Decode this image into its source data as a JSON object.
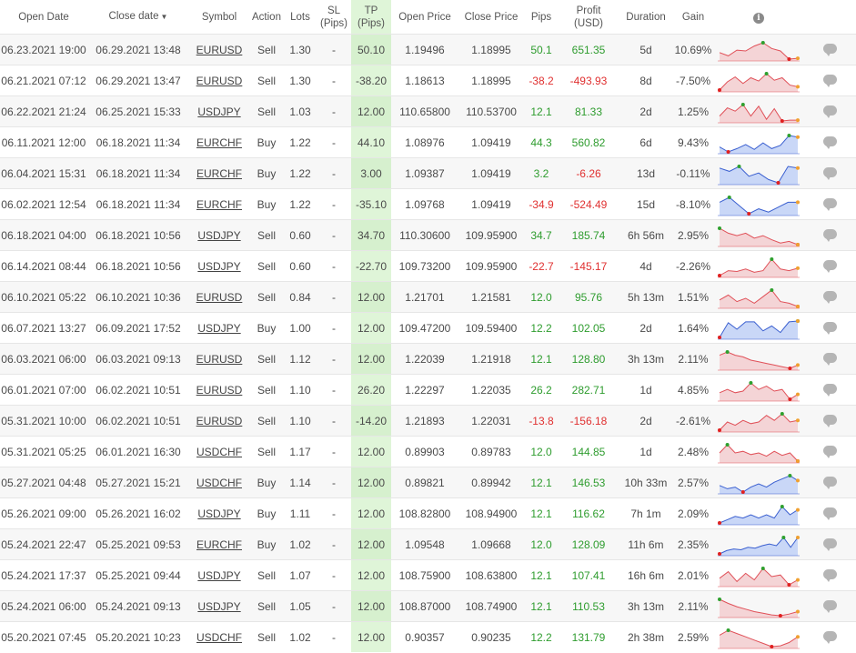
{
  "headers": {
    "open_date": "Open Date",
    "close_date": "Close date",
    "symbol": "Symbol",
    "action": "Action",
    "lots": "Lots",
    "sl": "SL",
    "sl_unit": "(Pips)",
    "tp": "TP",
    "tp_unit": "(Pips)",
    "open_price": "Open Price",
    "close_price": "Close Price",
    "pips": "Pips",
    "profit": "Profit",
    "profit_unit": "(USD)",
    "duration": "Duration",
    "gain": "Gain",
    "info_icon": "i"
  },
  "colors": {
    "positive": "#2e9c2e",
    "negative": "#e03030",
    "tp_bg": "#dff5d8",
    "sell_fill": "#f4d4d6",
    "sell_line": "#e05058",
    "buy_fill": "#c9d7f7",
    "buy_line": "#3a5fd0"
  },
  "trades": [
    {
      "open": "06.23.2021 19:00",
      "close": "06.29.2021 13:48",
      "symbol": "EURUSD",
      "action": "Sell",
      "lots": "1.30",
      "sl": "-",
      "tp": "50.10",
      "open_price": "1.19496",
      "close_price": "1.18995",
      "pips": "50.1",
      "profit": "651.35",
      "duration": "5d",
      "gain": "10.69%",
      "spark": [
        0.4,
        0.2,
        0.55,
        0.5,
        0.8,
        1.0,
        0.65,
        0.5,
        0.0,
        0.05
      ]
    },
    {
      "open": "06.21.2021 07:12",
      "close": "06.29.2021 13:47",
      "symbol": "EURUSD",
      "action": "Sell",
      "lots": "1.30",
      "sl": "-",
      "tp": "-38.20",
      "open_price": "1.18613",
      "close_price": "1.18995",
      "pips": "-38.2",
      "profit": "-493.93",
      "duration": "8d",
      "gain": "-7.50%",
      "spark": [
        0.0,
        0.5,
        0.8,
        0.4,
        0.75,
        0.55,
        1.0,
        0.6,
        0.75,
        0.3,
        0.2
      ]
    },
    {
      "open": "06.22.2021 21:24",
      "close": "06.25.2021 15:33",
      "symbol": "USDJPY",
      "action": "Sell",
      "lots": "1.03",
      "sl": "-",
      "tp": "12.00",
      "open_price": "110.65800",
      "close_price": "110.53700",
      "pips": "12.1",
      "profit": "81.33",
      "duration": "2d",
      "gain": "1.25%",
      "spark": [
        0.3,
        0.8,
        0.6,
        1.0,
        0.3,
        0.9,
        0.1,
        0.75,
        0.0,
        0.05,
        0.05
      ]
    },
    {
      "open": "06.11.2021 12:00",
      "close": "06.18.2021 11:34",
      "symbol": "EURCHF",
      "action": "Buy",
      "lots": "1.22",
      "sl": "-",
      "tp": "44.10",
      "open_price": "1.08976",
      "close_price": "1.09419",
      "pips": "44.3",
      "profit": "560.82",
      "duration": "6d",
      "gain": "9.43%",
      "spark": [
        0.3,
        0.0,
        0.2,
        0.45,
        0.15,
        0.55,
        0.2,
        0.4,
        1.0,
        0.9
      ]
    },
    {
      "open": "06.04.2021 15:31",
      "close": "06.18.2021 11:34",
      "symbol": "EURCHF",
      "action": "Buy",
      "lots": "1.22",
      "sl": "-",
      "tp": "3.00",
      "open_price": "1.09387",
      "close_price": "1.09419",
      "pips": "3.2",
      "profit": "-6.26",
      "duration": "13d",
      "gain": "-0.11%",
      "spark": [
        0.9,
        0.7,
        1.0,
        0.4,
        0.6,
        0.2,
        0.0,
        1.0,
        0.9
      ]
    },
    {
      "open": "06.02.2021 12:54",
      "close": "06.18.2021 11:34",
      "symbol": "EURCHF",
      "action": "Buy",
      "lots": "1.22",
      "sl": "-",
      "tp": "-35.10",
      "open_price": "1.09768",
      "close_price": "1.09419",
      "pips": "-34.9",
      "profit": "-524.49",
      "duration": "15d",
      "gain": "-8.10%",
      "spark": [
        0.7,
        1.0,
        0.5,
        0.0,
        0.3,
        0.1,
        0.4,
        0.7,
        0.7
      ]
    },
    {
      "open": "06.18.2021 04:00",
      "close": "06.18.2021 10:56",
      "symbol": "USDJPY",
      "action": "Sell",
      "lots": "0.60",
      "sl": "-",
      "tp": "34.70",
      "open_price": "110.30600",
      "close_price": "109.95900",
      "pips": "34.7",
      "profit": "185.74",
      "duration": "6h 56m",
      "gain": "2.95%",
      "spark": [
        1.0,
        0.7,
        0.55,
        0.7,
        0.4,
        0.55,
        0.3,
        0.1,
        0.2,
        0.0
      ]
    },
    {
      "open": "06.14.2021 08:44",
      "close": "06.18.2021 10:56",
      "symbol": "USDJPY",
      "action": "Sell",
      "lots": "0.60",
      "sl": "-",
      "tp": "-22.70",
      "open_price": "109.73200",
      "close_price": "109.95900",
      "pips": "-22.7",
      "profit": "-145.17",
      "duration": "4d",
      "gain": "-2.26%",
      "spark": [
        0.0,
        0.3,
        0.25,
        0.4,
        0.2,
        0.3,
        1.0,
        0.4,
        0.3,
        0.45
      ]
    },
    {
      "open": "06.10.2021 05:22",
      "close": "06.10.2021 10:36",
      "symbol": "EURUSD",
      "action": "Sell",
      "lots": "0.84",
      "sl": "-",
      "tp": "12.00",
      "open_price": "1.21701",
      "close_price": "1.21581",
      "pips": "12.0",
      "profit": "95.76",
      "duration": "5h 13m",
      "gain": "1.51%",
      "spark": [
        0.4,
        0.7,
        0.3,
        0.5,
        0.2,
        0.6,
        1.0,
        0.3,
        0.2,
        0.0
      ]
    },
    {
      "open": "06.07.2021 13:27",
      "close": "06.09.2021 17:52",
      "symbol": "USDJPY",
      "action": "Buy",
      "lots": "1.00",
      "sl": "-",
      "tp": "12.00",
      "open_price": "109.47200",
      "close_price": "109.59400",
      "pips": "12.2",
      "profit": "102.05",
      "duration": "2d",
      "gain": "1.64%",
      "spark": [
        0.0,
        0.9,
        0.5,
        0.95,
        0.95,
        0.4,
        0.7,
        0.3,
        0.95,
        1.0
      ]
    },
    {
      "open": "06.03.2021 06:00",
      "close": "06.03.2021 09:13",
      "symbol": "EURUSD",
      "action": "Sell",
      "lots": "1.12",
      "sl": "-",
      "tp": "12.00",
      "open_price": "1.22039",
      "close_price": "1.21918",
      "pips": "12.1",
      "profit": "128.80",
      "duration": "3h 13m",
      "gain": "2.11%",
      "spark": [
        0.8,
        1.0,
        0.8,
        0.7,
        0.5,
        0.4,
        0.3,
        0.2,
        0.1,
        0.0,
        0.2
      ]
    },
    {
      "open": "06.01.2021 07:00",
      "close": "06.02.2021 10:51",
      "symbol": "EURUSD",
      "action": "Sell",
      "lots": "1.10",
      "sl": "-",
      "tp": "26.20",
      "open_price": "1.22297",
      "close_price": "1.22035",
      "pips": "26.2",
      "profit": "282.71",
      "duration": "1d",
      "gain": "4.85%",
      "spark": [
        0.4,
        0.6,
        0.4,
        0.5,
        1.0,
        0.6,
        0.8,
        0.5,
        0.6,
        0.0,
        0.3
      ]
    },
    {
      "open": "05.31.2021 10:00",
      "close": "06.02.2021 10:51",
      "symbol": "EURUSD",
      "action": "Sell",
      "lots": "1.10",
      "sl": "-",
      "tp": "-14.20",
      "open_price": "1.21893",
      "close_price": "1.22031",
      "pips": "-13.8",
      "profit": "-156.18",
      "duration": "2d",
      "gain": "-2.61%",
      "spark": [
        0.0,
        0.5,
        0.3,
        0.6,
        0.4,
        0.5,
        0.9,
        0.6,
        1.0,
        0.5,
        0.6
      ]
    },
    {
      "open": "05.31.2021 05:25",
      "close": "06.01.2021 16:30",
      "symbol": "USDCHF",
      "action": "Sell",
      "lots": "1.17",
      "sl": "-",
      "tp": "12.00",
      "open_price": "0.89903",
      "close_price": "0.89783",
      "pips": "12.0",
      "profit": "144.85",
      "duration": "1d",
      "gain": "2.48%",
      "spark": [
        0.5,
        1.0,
        0.5,
        0.6,
        0.4,
        0.5,
        0.3,
        0.6,
        0.35,
        0.5,
        0.0
      ]
    },
    {
      "open": "05.27.2021 04:48",
      "close": "05.27.2021 15:21",
      "symbol": "USDCHF",
      "action": "Buy",
      "lots": "1.14",
      "sl": "-",
      "tp": "12.00",
      "open_price": "0.89821",
      "close_price": "0.89942",
      "pips": "12.1",
      "profit": "146.53",
      "duration": "10h 33m",
      "gain": "2.57%",
      "spark": [
        0.4,
        0.2,
        0.3,
        0.0,
        0.3,
        0.5,
        0.3,
        0.6,
        0.8,
        1.0,
        0.7
      ]
    },
    {
      "open": "05.26.2021 09:00",
      "close": "05.26.2021 16:02",
      "symbol": "USDJPY",
      "action": "Buy",
      "lots": "1.11",
      "sl": "-",
      "tp": "12.00",
      "open_price": "108.82800",
      "close_price": "108.94900",
      "pips": "12.1",
      "profit": "116.62",
      "duration": "7h 1m",
      "gain": "2.09%",
      "spark": [
        0.0,
        0.2,
        0.4,
        0.3,
        0.5,
        0.3,
        0.5,
        0.3,
        1.0,
        0.5,
        0.8
      ]
    },
    {
      "open": "05.24.2021 22:47",
      "close": "05.25.2021 09:53",
      "symbol": "EURCHF",
      "action": "Buy",
      "lots": "1.02",
      "sl": "-",
      "tp": "12.00",
      "open_price": "1.09548",
      "close_price": "1.09668",
      "pips": "12.0",
      "profit": "128.09",
      "duration": "11h 6m",
      "gain": "2.35%",
      "spark": [
        0.0,
        0.2,
        0.3,
        0.25,
        0.4,
        0.35,
        0.5,
        0.6,
        0.5,
        1.0,
        0.4,
        1.0
      ]
    },
    {
      "open": "05.24.2021 17:37",
      "close": "05.25.2021 09:44",
      "symbol": "USDJPY",
      "action": "Sell",
      "lots": "1.07",
      "sl": "-",
      "tp": "12.00",
      "open_price": "108.75900",
      "close_price": "108.63800",
      "pips": "12.1",
      "profit": "107.41",
      "duration": "16h 6m",
      "gain": "2.01%",
      "spark": [
        0.4,
        0.8,
        0.2,
        0.7,
        0.3,
        1.0,
        0.5,
        0.6,
        0.0,
        0.3
      ]
    },
    {
      "open": "05.24.2021 06:00",
      "close": "05.24.2021 09:13",
      "symbol": "USDJPY",
      "action": "Sell",
      "lots": "1.05",
      "sl": "-",
      "tp": "12.00",
      "open_price": "108.87000",
      "close_price": "108.74900",
      "pips": "12.1",
      "profit": "110.53",
      "duration": "3h 13m",
      "gain": "2.11%",
      "spark": [
        1.0,
        0.75,
        0.55,
        0.4,
        0.25,
        0.15,
        0.05,
        0.0,
        0.1,
        0.25
      ]
    },
    {
      "open": "05.20.2021 07:45",
      "close": "05.20.2021 10:23",
      "symbol": "USDCHF",
      "action": "Sell",
      "lots": "1.02",
      "sl": "-",
      "tp": "12.00",
      "open_price": "0.90357",
      "close_price": "0.90235",
      "pips": "12.2",
      "profit": "131.79",
      "duration": "2h 38m",
      "gain": "2.59%",
      "spark": [
        0.7,
        1.0,
        0.8,
        0.6,
        0.4,
        0.2,
        0.0,
        0.05,
        0.25,
        0.6
      ]
    }
  ]
}
